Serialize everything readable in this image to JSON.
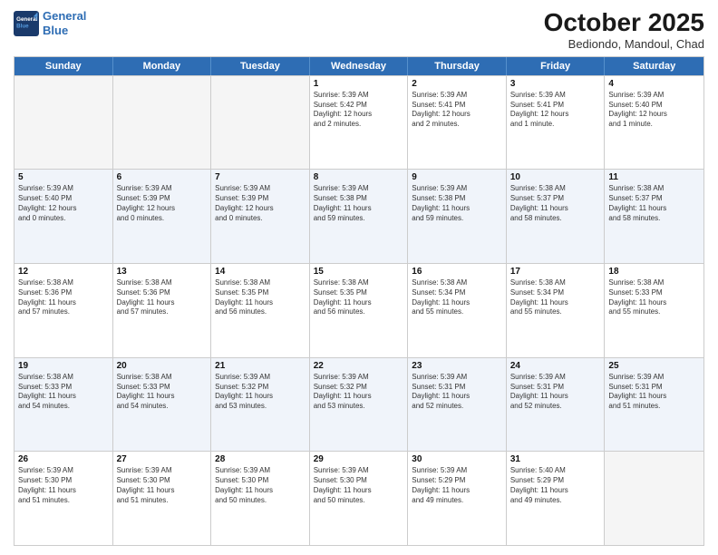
{
  "logo": {
    "line1": "General",
    "line2": "Blue"
  },
  "title": "October 2025",
  "subtitle": "Bediondo, Mandoul, Chad",
  "days": [
    "Sunday",
    "Monday",
    "Tuesday",
    "Wednesday",
    "Thursday",
    "Friday",
    "Saturday"
  ],
  "weeks": [
    [
      {
        "day": "",
        "info": ""
      },
      {
        "day": "",
        "info": ""
      },
      {
        "day": "",
        "info": ""
      },
      {
        "day": "1",
        "info": "Sunrise: 5:39 AM\nSunset: 5:42 PM\nDaylight: 12 hours\nand 2 minutes."
      },
      {
        "day": "2",
        "info": "Sunrise: 5:39 AM\nSunset: 5:41 PM\nDaylight: 12 hours\nand 2 minutes."
      },
      {
        "day": "3",
        "info": "Sunrise: 5:39 AM\nSunset: 5:41 PM\nDaylight: 12 hours\nand 1 minute."
      },
      {
        "day": "4",
        "info": "Sunrise: 5:39 AM\nSunset: 5:40 PM\nDaylight: 12 hours\nand 1 minute."
      }
    ],
    [
      {
        "day": "5",
        "info": "Sunrise: 5:39 AM\nSunset: 5:40 PM\nDaylight: 12 hours\nand 0 minutes."
      },
      {
        "day": "6",
        "info": "Sunrise: 5:39 AM\nSunset: 5:39 PM\nDaylight: 12 hours\nand 0 minutes."
      },
      {
        "day": "7",
        "info": "Sunrise: 5:39 AM\nSunset: 5:39 PM\nDaylight: 12 hours\nand 0 minutes."
      },
      {
        "day": "8",
        "info": "Sunrise: 5:39 AM\nSunset: 5:38 PM\nDaylight: 11 hours\nand 59 minutes."
      },
      {
        "day": "9",
        "info": "Sunrise: 5:39 AM\nSunset: 5:38 PM\nDaylight: 11 hours\nand 59 minutes."
      },
      {
        "day": "10",
        "info": "Sunrise: 5:38 AM\nSunset: 5:37 PM\nDaylight: 11 hours\nand 58 minutes."
      },
      {
        "day": "11",
        "info": "Sunrise: 5:38 AM\nSunset: 5:37 PM\nDaylight: 11 hours\nand 58 minutes."
      }
    ],
    [
      {
        "day": "12",
        "info": "Sunrise: 5:38 AM\nSunset: 5:36 PM\nDaylight: 11 hours\nand 57 minutes."
      },
      {
        "day": "13",
        "info": "Sunrise: 5:38 AM\nSunset: 5:36 PM\nDaylight: 11 hours\nand 57 minutes."
      },
      {
        "day": "14",
        "info": "Sunrise: 5:38 AM\nSunset: 5:35 PM\nDaylight: 11 hours\nand 56 minutes."
      },
      {
        "day": "15",
        "info": "Sunrise: 5:38 AM\nSunset: 5:35 PM\nDaylight: 11 hours\nand 56 minutes."
      },
      {
        "day": "16",
        "info": "Sunrise: 5:38 AM\nSunset: 5:34 PM\nDaylight: 11 hours\nand 55 minutes."
      },
      {
        "day": "17",
        "info": "Sunrise: 5:38 AM\nSunset: 5:34 PM\nDaylight: 11 hours\nand 55 minutes."
      },
      {
        "day": "18",
        "info": "Sunrise: 5:38 AM\nSunset: 5:33 PM\nDaylight: 11 hours\nand 55 minutes."
      }
    ],
    [
      {
        "day": "19",
        "info": "Sunrise: 5:38 AM\nSunset: 5:33 PM\nDaylight: 11 hours\nand 54 minutes."
      },
      {
        "day": "20",
        "info": "Sunrise: 5:38 AM\nSunset: 5:33 PM\nDaylight: 11 hours\nand 54 minutes."
      },
      {
        "day": "21",
        "info": "Sunrise: 5:39 AM\nSunset: 5:32 PM\nDaylight: 11 hours\nand 53 minutes."
      },
      {
        "day": "22",
        "info": "Sunrise: 5:39 AM\nSunset: 5:32 PM\nDaylight: 11 hours\nand 53 minutes."
      },
      {
        "day": "23",
        "info": "Sunrise: 5:39 AM\nSunset: 5:31 PM\nDaylight: 11 hours\nand 52 minutes."
      },
      {
        "day": "24",
        "info": "Sunrise: 5:39 AM\nSunset: 5:31 PM\nDaylight: 11 hours\nand 52 minutes."
      },
      {
        "day": "25",
        "info": "Sunrise: 5:39 AM\nSunset: 5:31 PM\nDaylight: 11 hours\nand 51 minutes."
      }
    ],
    [
      {
        "day": "26",
        "info": "Sunrise: 5:39 AM\nSunset: 5:30 PM\nDaylight: 11 hours\nand 51 minutes."
      },
      {
        "day": "27",
        "info": "Sunrise: 5:39 AM\nSunset: 5:30 PM\nDaylight: 11 hours\nand 51 minutes."
      },
      {
        "day": "28",
        "info": "Sunrise: 5:39 AM\nSunset: 5:30 PM\nDaylight: 11 hours\nand 50 minutes."
      },
      {
        "day": "29",
        "info": "Sunrise: 5:39 AM\nSunset: 5:30 PM\nDaylight: 11 hours\nand 50 minutes."
      },
      {
        "day": "30",
        "info": "Sunrise: 5:39 AM\nSunset: 5:29 PM\nDaylight: 11 hours\nand 49 minutes."
      },
      {
        "day": "31",
        "info": "Sunrise: 5:40 AM\nSunset: 5:29 PM\nDaylight: 11 hours\nand 49 minutes."
      },
      {
        "day": "",
        "info": ""
      }
    ]
  ],
  "alt_rows": [
    1,
    3
  ],
  "colors": {
    "header_bg": "#2e6db4",
    "alt_row_bg": "#e8eef7",
    "empty_bg": "#f0f0f0"
  }
}
